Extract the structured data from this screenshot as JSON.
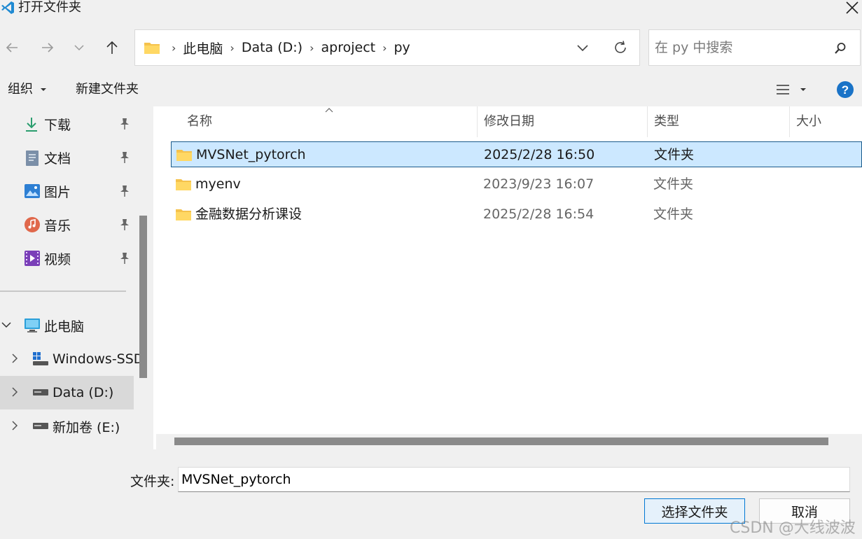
{
  "window": {
    "title": "打开文件夹",
    "close_icon": "close-icon"
  },
  "nav": {
    "back": "back-arrow-icon",
    "forward": "forward-arrow-icon",
    "recent": "chevron-down-icon",
    "up": "up-arrow-icon"
  },
  "address": {
    "crumbs": [
      "此电脑",
      "Data (D:)",
      "aproject",
      "py"
    ],
    "separator": "›"
  },
  "search": {
    "placeholder": "在 py 中搜索"
  },
  "toolbar": {
    "organize": "组织",
    "new_folder": "新建文件夹"
  },
  "sidebar": {
    "quick": [
      {
        "label": "下载",
        "icon": "download-icon"
      },
      {
        "label": "文档",
        "icon": "document-icon"
      },
      {
        "label": "图片",
        "icon": "pictures-icon"
      },
      {
        "label": "音乐",
        "icon": "music-icon"
      },
      {
        "label": "视频",
        "icon": "video-icon"
      }
    ],
    "this_pc": "此电脑",
    "drives": [
      {
        "label": "Windows-SSD"
      },
      {
        "label": "Data (D:)"
      },
      {
        "label": "新加卷 (E:)"
      }
    ]
  },
  "columns": {
    "name": "名称",
    "modified": "修改日期",
    "type": "类型",
    "size": "大小"
  },
  "files": [
    {
      "name": "MVSNet_pytorch",
      "modified": "2025/2/28 16:50",
      "type": "文件夹"
    },
    {
      "name": "myenv",
      "modified": "2023/9/23 16:07",
      "type": "文件夹"
    },
    {
      "name": "金融数据分析课设",
      "modified": "2025/2/28 16:54",
      "type": "文件夹"
    }
  ],
  "footer": {
    "folder_label": "文件夹:",
    "folder_value": "MVSNet_pytorch",
    "ok": "选择文件夹",
    "cancel": "取消"
  },
  "watermark": "CSDN @大线波波",
  "colors": {
    "selection_bg": "#cce8ff",
    "accent": "#0078d4",
    "help": "#1a73c7",
    "folder": "#f5c24c"
  }
}
